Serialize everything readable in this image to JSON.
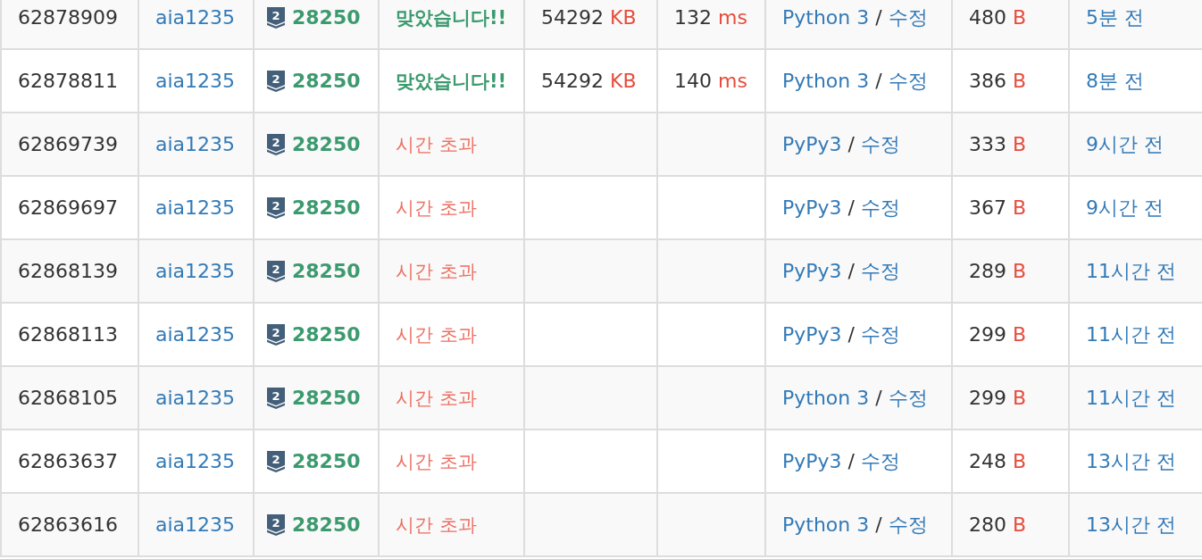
{
  "rows": [
    {
      "id": "62878909",
      "user": "aia1235",
      "tier": "2",
      "problem": "28250",
      "result": {
        "kind": "accepted",
        "text": "맞았습니다!!"
      },
      "memory": "54292",
      "memory_unit": "KB",
      "time": "132",
      "time_unit": "ms",
      "language": "Python 3",
      "separator": "/",
      "edit": "수정",
      "size": "480",
      "size_unit": "B",
      "submitted": "5분 전"
    },
    {
      "id": "62878811",
      "user": "aia1235",
      "tier": "2",
      "problem": "28250",
      "result": {
        "kind": "accepted",
        "text": "맞았습니다!!"
      },
      "memory": "54292",
      "memory_unit": "KB",
      "time": "140",
      "time_unit": "ms",
      "language": "Python 3",
      "separator": "/",
      "edit": "수정",
      "size": "386",
      "size_unit": "B",
      "submitted": "8분 전"
    },
    {
      "id": "62869739",
      "user": "aia1235",
      "tier": "2",
      "problem": "28250",
      "result": {
        "kind": "time_limit",
        "text": "시간 초과"
      },
      "language": "PyPy3",
      "separator": "/",
      "edit": "수정",
      "size": "333",
      "size_unit": "B",
      "submitted": "9시간 전"
    },
    {
      "id": "62869697",
      "user": "aia1235",
      "tier": "2",
      "problem": "28250",
      "result": {
        "kind": "time_limit",
        "text": "시간 초과"
      },
      "language": "PyPy3",
      "separator": "/",
      "edit": "수정",
      "size": "367",
      "size_unit": "B",
      "submitted": "9시간 전"
    },
    {
      "id": "62868139",
      "user": "aia1235",
      "tier": "2",
      "problem": "28250",
      "result": {
        "kind": "time_limit",
        "text": "시간 초과"
      },
      "language": "PyPy3",
      "separator": "/",
      "edit": "수정",
      "size": "289",
      "size_unit": "B",
      "submitted": "11시간 전"
    },
    {
      "id": "62868113",
      "user": "aia1235",
      "tier": "2",
      "problem": "28250",
      "result": {
        "kind": "time_limit",
        "text": "시간 초과"
      },
      "language": "PyPy3",
      "separator": "/",
      "edit": "수정",
      "size": "299",
      "size_unit": "B",
      "submitted": "11시간 전"
    },
    {
      "id": "62868105",
      "user": "aia1235",
      "tier": "2",
      "problem": "28250",
      "result": {
        "kind": "time_limit",
        "text": "시간 초과"
      },
      "language": "Python 3",
      "separator": "/",
      "edit": "수정",
      "size": "299",
      "size_unit": "B",
      "submitted": "11시간 전"
    },
    {
      "id": "62863637",
      "user": "aia1235",
      "tier": "2",
      "problem": "28250",
      "result": {
        "kind": "time_limit",
        "text": "시간 초과"
      },
      "language": "PyPy3",
      "separator": "/",
      "edit": "수정",
      "size": "248",
      "size_unit": "B",
      "submitted": "13시간 전"
    },
    {
      "id": "62863616",
      "user": "aia1235",
      "tier": "2",
      "problem": "28250",
      "result": {
        "kind": "time_limit",
        "text": "시간 초과"
      },
      "language": "Python 3",
      "separator": "/",
      "edit": "수정",
      "size": "280",
      "size_unit": "B",
      "submitted": "13시간 전"
    }
  ]
}
